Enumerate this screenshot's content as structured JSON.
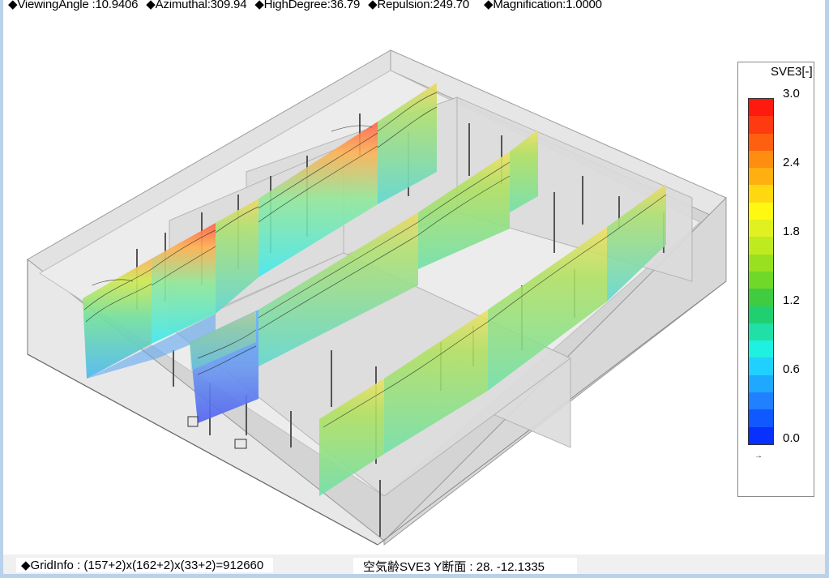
{
  "header": {
    "viewing_angle": "◆ViewingAngle :10.9406",
    "azimuthal": "◆Azimuthal:309.94",
    "high_degree": "◆HighDegree:36.79",
    "repulsion": "◆Repulsion:249.70",
    "magnification": "◆Magnification:1.0000"
  },
  "legend": {
    "title": "SVE3[-]",
    "ticks": [
      "3.0",
      "2.4",
      "1.8",
      "1.2",
      "0.6",
      "0.0"
    ],
    "arrow": "→",
    "colors": [
      "#ff1a10",
      "#ff3a10",
      "#ff6010",
      "#ff8e10",
      "#ffb010",
      "#ffd810",
      "#fff810",
      "#e0f020",
      "#c0ea20",
      "#98e020",
      "#70d828",
      "#40cc40",
      "#20d070",
      "#20e0a8",
      "#20f0e0",
      "#20d0ff",
      "#20a8ff",
      "#2080ff",
      "#1058ff",
      "#0830ff"
    ]
  },
  "footer": {
    "grid_info": "◆GridInfo : (157+2)x(162+2)x(33+2)=912660",
    "section_info": "空気齢SVE3 Y断面 : 28.  -12.1335"
  }
}
